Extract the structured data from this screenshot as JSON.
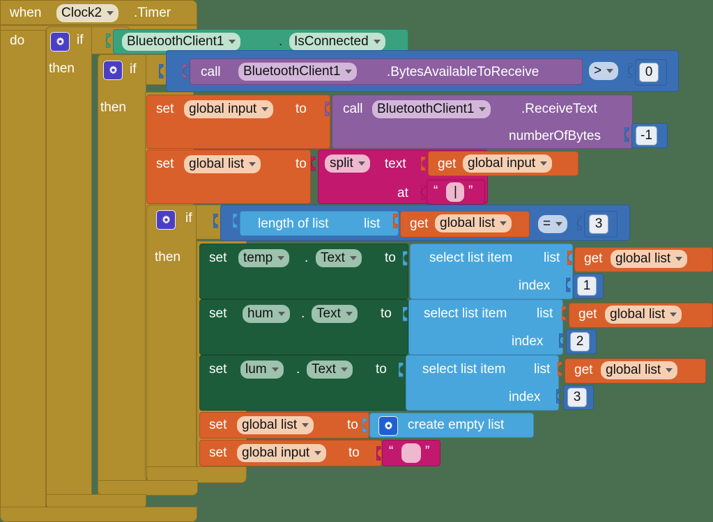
{
  "app": {
    "name": "MIT App Inventor Blocks Editor",
    "canvas_background": "#4a6e50"
  },
  "colors": {
    "control": "#b18e2e",
    "component_getter": "#3aa17e",
    "component_setter": "#1d5c3a",
    "math": "#3a6fb5",
    "procedure_call": "#8b5fa0",
    "variable": "#d9602b",
    "text": "#c2186d",
    "list": "#49a6dc"
  },
  "event": {
    "when_label": "when",
    "component": "Clock2",
    "event_name": ".Timer",
    "do_label": "do"
  },
  "outer_if": {
    "if_label": "if",
    "then_label": "then",
    "condition": {
      "component": "BluetoothClient1",
      "dot": ".",
      "property": "IsConnected"
    }
  },
  "inner_if": {
    "if_label": "if",
    "then_label": "then",
    "condition": {
      "call_label": "call",
      "component": "BluetoothClient1",
      "method": ".BytesAvailableToReceive",
      "operator": ">",
      "compare_value": "0"
    }
  },
  "statements": {
    "set_global_input_receive": {
      "set_label": "set",
      "variable": "global input",
      "to_label": "to",
      "call_label": "call",
      "component": "BluetoothClient1",
      "method": ".ReceiveText",
      "arg_label": "numberOfBytes",
      "arg_value": "-1"
    },
    "set_global_list_split": {
      "set_label": "set",
      "variable": "global list",
      "to_label": "to",
      "split_label": "split",
      "text_label": "text",
      "get_label": "get",
      "get_variable": "global input",
      "at_label": "at",
      "at_value": "|"
    }
  },
  "length_if": {
    "if_label": "if",
    "then_label": "then",
    "condition": {
      "length_label": "length of list",
      "list_label": "list",
      "get_label": "get",
      "get_variable": "global list",
      "operator": "=",
      "compare_value": "3"
    }
  },
  "setters": [
    {
      "set_label": "set",
      "component": "temp",
      "dot": ".",
      "property": "Text",
      "to_label": "to",
      "select_label": "select list item",
      "list_label": "list",
      "get_label": "get",
      "get_variable": "global list",
      "index_label": "index",
      "index_value": "1"
    },
    {
      "set_label": "set",
      "component": "hum",
      "dot": ".",
      "property": "Text",
      "to_label": "to",
      "select_label": "select list item",
      "list_label": "list",
      "get_label": "get",
      "get_variable": "global list",
      "index_label": "index",
      "index_value": "2"
    },
    {
      "set_label": "set",
      "component": "lum",
      "dot": ".",
      "property": "Text",
      "to_label": "to",
      "select_label": "select list item",
      "list_label": "list",
      "get_label": "get",
      "get_variable": "global list",
      "index_label": "index",
      "index_value": "3"
    }
  ],
  "reset": {
    "set_list": {
      "set_label": "set",
      "variable": "global list",
      "to_label": "to",
      "create_label": "create empty list"
    },
    "set_input": {
      "set_label": "set",
      "variable": "global input",
      "to_label": "to",
      "text_value": ""
    }
  },
  "icons": {
    "gear": "gear-icon",
    "dropdown": "chevron-down-icon",
    "quote_open": "“",
    "quote_close": "”"
  }
}
